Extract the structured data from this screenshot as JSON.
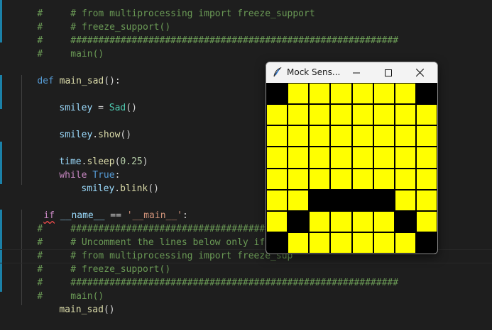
{
  "editor": {
    "lines": [
      {
        "prefix": "#",
        "indent": "     ",
        "text": "# from multiprocessing import freeze_support",
        "kind": "comment"
      },
      {
        "prefix": "#",
        "indent": "     ",
        "text": "# freeze_support()",
        "kind": "comment"
      },
      {
        "prefix": "#",
        "indent": "     ",
        "text": "###########################################################",
        "kind": "comment"
      },
      {
        "prefix": "#",
        "indent": "     ",
        "text": "main()",
        "kind": "comment"
      },
      {
        "prefix": "",
        "indent": "",
        "text": "",
        "kind": "blank"
      },
      {
        "prefix": "",
        "indent": "",
        "text": "def main_sad():",
        "kind": "def"
      },
      {
        "prefix": "",
        "indent": "",
        "text": "",
        "kind": "blank"
      },
      {
        "prefix": "",
        "indent": "",
        "text": "smiley = Sad()",
        "kind": "code"
      },
      {
        "prefix": "",
        "indent": "",
        "text": "",
        "kind": "blank"
      },
      {
        "prefix": "",
        "indent": "",
        "text": "smiley.show()",
        "kind": "code"
      },
      {
        "prefix": "",
        "indent": "",
        "text": "",
        "kind": "blank"
      },
      {
        "prefix": "",
        "indent": "",
        "text": "time.sleep(0.25)",
        "kind": "code"
      },
      {
        "prefix": "",
        "indent": "",
        "text": "while True:",
        "kind": "code"
      },
      {
        "prefix": "",
        "indent": "",
        "text": "smiley.blink()",
        "kind": "code"
      },
      {
        "prefix": "",
        "indent": "",
        "text": "",
        "kind": "blank"
      },
      {
        "prefix": "",
        "indent": "",
        "text": "if __name__ == '__main__':",
        "kind": "code"
      },
      {
        "prefix": "#",
        "indent": "     ",
        "text": "###########################################################",
        "kind": "comment"
      },
      {
        "prefix": "#",
        "indent": "     ",
        "text": "# Uncomment the lines below only if you",
        "kind": "comment"
      },
      {
        "prefix": "#",
        "indent": "     ",
        "text": "# from multiprocessing import freeze_sup",
        "kind": "comment"
      },
      {
        "prefix": "#",
        "indent": "     ",
        "text": "# freeze_support()",
        "kind": "comment"
      },
      {
        "prefix": "#",
        "indent": "     ",
        "text": "###########################################################",
        "kind": "comment"
      },
      {
        "prefix": "#",
        "indent": "     ",
        "text": "main()",
        "kind": "comment"
      },
      {
        "prefix": "",
        "indent": "",
        "text": "main_sad()",
        "kind": "code"
      }
    ]
  },
  "window": {
    "title": "Mock Sens...",
    "icon": "tk-feather-icon",
    "controls": [
      "minimize-icon",
      "maximize-icon",
      "close-icon"
    ]
  },
  "display": {
    "colors": {
      "on": "#ffff00",
      "off": "#000000"
    },
    "pixels": [
      [
        0,
        1,
        1,
        1,
        1,
        1,
        1,
        0
      ],
      [
        1,
        1,
        1,
        1,
        1,
        1,
        1,
        1
      ],
      [
        1,
        1,
        1,
        1,
        1,
        1,
        1,
        1
      ],
      [
        1,
        1,
        1,
        1,
        1,
        1,
        1,
        1
      ],
      [
        1,
        1,
        1,
        1,
        1,
        1,
        1,
        1
      ],
      [
        1,
        1,
        0,
        0,
        0,
        0,
        1,
        1
      ],
      [
        1,
        0,
        1,
        1,
        1,
        1,
        0,
        1
      ],
      [
        0,
        1,
        1,
        1,
        1,
        1,
        1,
        0
      ]
    ]
  }
}
